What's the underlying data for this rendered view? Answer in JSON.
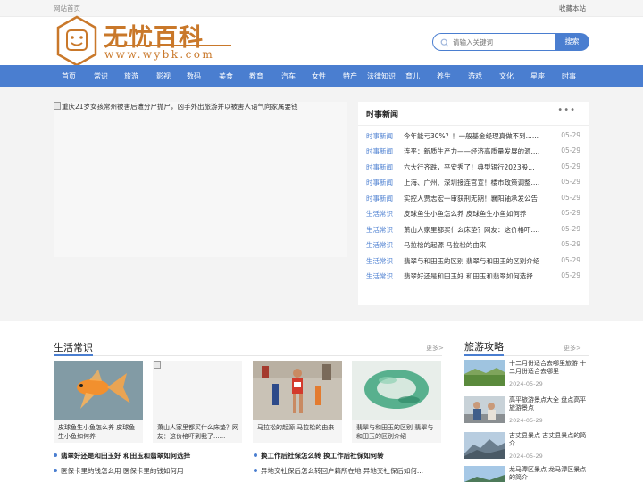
{
  "topbar": {
    "home_link": "网站首页",
    "bookmark": "收藏本站"
  },
  "logo": {
    "title": "无忧百科",
    "domain": "www.wybk.com",
    "color": "#c9782a"
  },
  "search": {
    "placeholder": "请输入关键词",
    "button": "搜索"
  },
  "nav": {
    "color": "#4a7ed0",
    "items": [
      "首页",
      "常识",
      "旅游",
      "影视",
      "数码",
      "美食",
      "教育",
      "汽车",
      "女性",
      "特产",
      "法律知识",
      "育儿",
      "养生",
      "游戏",
      "文化",
      "星座",
      "时事"
    ]
  },
  "hero": {
    "caption": "重庆21岁女孩常州被害后遭分尸抛尸，凶手外出旅游并以被害人语气向家属要钱"
  },
  "news": {
    "title": "时事新闻",
    "more": "•••",
    "rows": [
      {
        "cat": "时事新闻",
        "title": "今年能亏30%？！一般基金经理真做不到......",
        "date": "05-29"
      },
      {
        "cat": "时事新闻",
        "title": "连平：新质生产力——经济高质量发展的源......",
        "date": "05-29"
      },
      {
        "cat": "时事新闻",
        "title": "六大行齐跌，平安秀了！典型银行2023股息......",
        "date": "05-29"
      },
      {
        "cat": "时事新闻",
        "title": "上海、广州、深圳接连官宣！楼市政策调整......",
        "date": "05-29"
      },
      {
        "cat": "时事新闻",
        "title": "实控人贾志宏一审获刑无期！襄阳轴承发公告",
        "date": "05-29"
      },
      {
        "cat": "生活常识",
        "title": "皮球鱼生小鱼怎么养 皮球鱼生小鱼如何养",
        "date": "05-29"
      },
      {
        "cat": "生活常识",
        "title": "萧山人家里都买什么床垫？网友：这价格吓......",
        "date": "05-29"
      },
      {
        "cat": "生活常识",
        "title": "马拉松的起源 马拉松的由来",
        "date": "05-29"
      },
      {
        "cat": "生活常识",
        "title": "翡翠与和田玉的区别 翡翠与和田玉的区别介绍",
        "date": "05-29"
      },
      {
        "cat": "生活常识",
        "title": "翡翠好还是和田玉好 和田玉和翡翠如何选择",
        "date": "05-29"
      }
    ]
  },
  "life": {
    "title": "生活常识",
    "more": "更多>",
    "cards": [
      {
        "caption": "皮球鱼生小鱼怎么养 皮球鱼生小鱼如何养",
        "image": "goldfish-photo"
      },
      {
        "caption": "萧山人家里都买什么床垫？网友：这价格吓到我了......",
        "image": "broken-image"
      },
      {
        "caption": "马拉松的起源 马拉松的由来",
        "image": "marathon-photo"
      },
      {
        "caption": "翡翠与和田玉的区别 翡翠与和田玉的区别介绍",
        "image": "jade-bracelet-photo"
      }
    ],
    "list": [
      {
        "text": "翡翠好还是和田玉好 和田玉和翡翠如何选择",
        "bold": true
      },
      {
        "text": "换工作后社保怎么转 换工作后社保如何转",
        "bold": true
      },
      {
        "text": "医保卡里的钱怎么用 医保卡里的钱如何用",
        "bold": false
      },
      {
        "text": "异地交社保后怎么转回户籍所在地 异地交社保后如何...",
        "bold": false
      }
    ]
  },
  "travel": {
    "title": "旅游攻略",
    "more": "更多>",
    "items": [
      {
        "title": "十二月份适合去哪里旅游 十二月份适合去哪里",
        "date": "2024-05-29",
        "image": "landscape-photo"
      },
      {
        "title": "高平旅游景点大全 盘点高平旅游景点",
        "date": "2024-05-29",
        "image": "people-photo"
      },
      {
        "title": "古丈县景点 古丈县景点的简介",
        "date": "2024-05-29",
        "image": "mountain-photo"
      },
      {
        "title": "龙马潭区景点 龙马潭区景点的简介",
        "date": "",
        "image": "landscape-photo-2"
      }
    ]
  }
}
